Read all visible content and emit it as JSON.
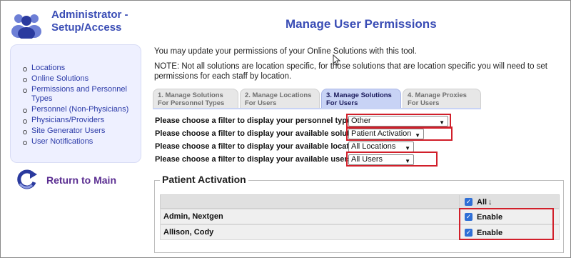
{
  "sidebar": {
    "title": "Administrator - Setup/Access",
    "items": [
      {
        "label": "Locations"
      },
      {
        "label": "Online Solutions"
      },
      {
        "label": "Permissions and Personnel Types"
      },
      {
        "label": "Personnel (Non-Physicians)"
      },
      {
        "label": "Physicians/Providers"
      },
      {
        "label": "Site Generator Users"
      },
      {
        "label": "User Notifications"
      }
    ],
    "return_label": "Return to Main"
  },
  "main": {
    "title": "Manage User Permissions",
    "intro": "You may update your permissions of your Online Solutions with this tool.",
    "note": "NOTE: Not all solutions are location specific, for those solutions that are location specific you will need to set permissions for each staff by location.",
    "tabs": [
      {
        "label": "1. Manage Solutions For Personnel Types",
        "active": false
      },
      {
        "label": "2. Manage Locations For Users",
        "active": false
      },
      {
        "label": "3. Manage Solutions For Users",
        "active": true
      },
      {
        "label": "4. Manage Proxies For Users",
        "active": false
      }
    ],
    "filters": [
      {
        "label": "Please choose a filter to display your personnel types *",
        "value": "Other"
      },
      {
        "label": "Please choose a filter to display your available solutions",
        "value": "Patient Activation"
      },
      {
        "label": "Please choose a filter to display your available locations",
        "value": "All Locations"
      },
      {
        "label": "Please choose a filter to display your available users",
        "value": "All Users"
      }
    ],
    "section": {
      "legend": "Patient Activation",
      "header_all_label": "All",
      "header_sort_glyph": "↓",
      "rows": [
        {
          "name": "Admin, Nextgen",
          "checkbox_label": "Enable",
          "checked": true
        },
        {
          "name": "Allison, Cody",
          "checkbox_label": "Enable",
          "checked": true
        }
      ]
    }
  },
  "colors": {
    "title_blue": "#3a4db5",
    "link_blue": "#2b3aa8",
    "return_purple": "#5a2d91",
    "highlight_red": "#d11f2a",
    "active_tab": "#c8d3f5",
    "checkbox_blue": "#2f6fd6"
  },
  "icons": {
    "users": "users-group-icon",
    "return": "refresh-arrows-icon",
    "cursor": "mouse-pointer-icon"
  }
}
